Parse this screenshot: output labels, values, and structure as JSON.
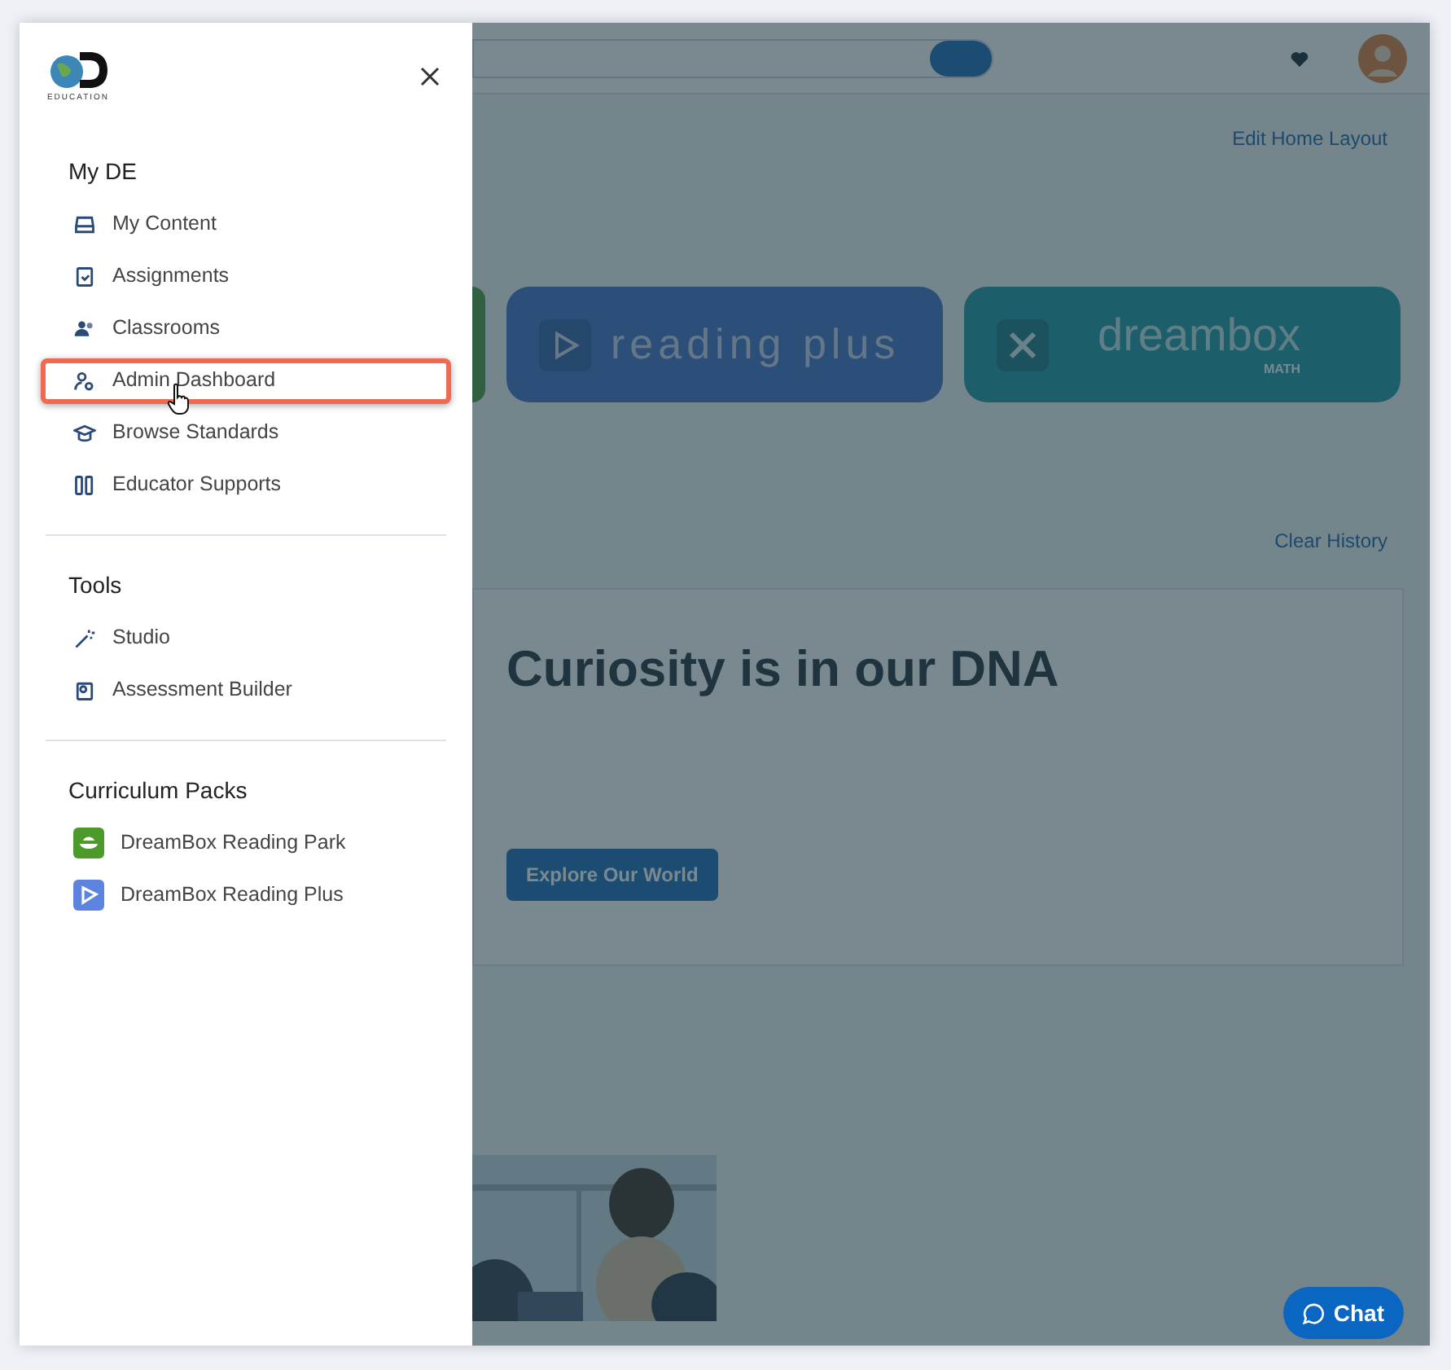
{
  "logo": {
    "caption": "EDUCATION"
  },
  "sections": [
    {
      "title": "My DE",
      "items": [
        {
          "label": "My Content",
          "selected": false
        },
        {
          "label": "Assignments",
          "selected": false
        },
        {
          "label": "Classrooms",
          "selected": false
        },
        {
          "label": "Admin Dashboard",
          "selected": true
        },
        {
          "label": "Browse Standards",
          "selected": false
        },
        {
          "label": "Educator Supports",
          "selected": false
        }
      ]
    },
    {
      "title": "Tools",
      "items": [
        {
          "label": "Studio",
          "selected": false
        },
        {
          "label": "Assessment Builder",
          "selected": false
        }
      ]
    },
    {
      "title": "Curriculum Packs",
      "items": [
        {
          "label": "DreamBox Reading Park",
          "selected": false
        },
        {
          "label": "DreamBox Reading Plus",
          "selected": false
        }
      ]
    }
  ],
  "background": {
    "edit_link": "Edit Home Layout",
    "cards": [
      {
        "kind": "partial"
      },
      {
        "kind": "reading",
        "label": "reading plus"
      },
      {
        "kind": "math",
        "label": "dreambox",
        "sublabel": "MATH"
      }
    ],
    "clear_link": "Clear History",
    "promo": {
      "title": "Curiosity is in our DNA",
      "button": "Explore Our World"
    },
    "chat": "Chat"
  }
}
